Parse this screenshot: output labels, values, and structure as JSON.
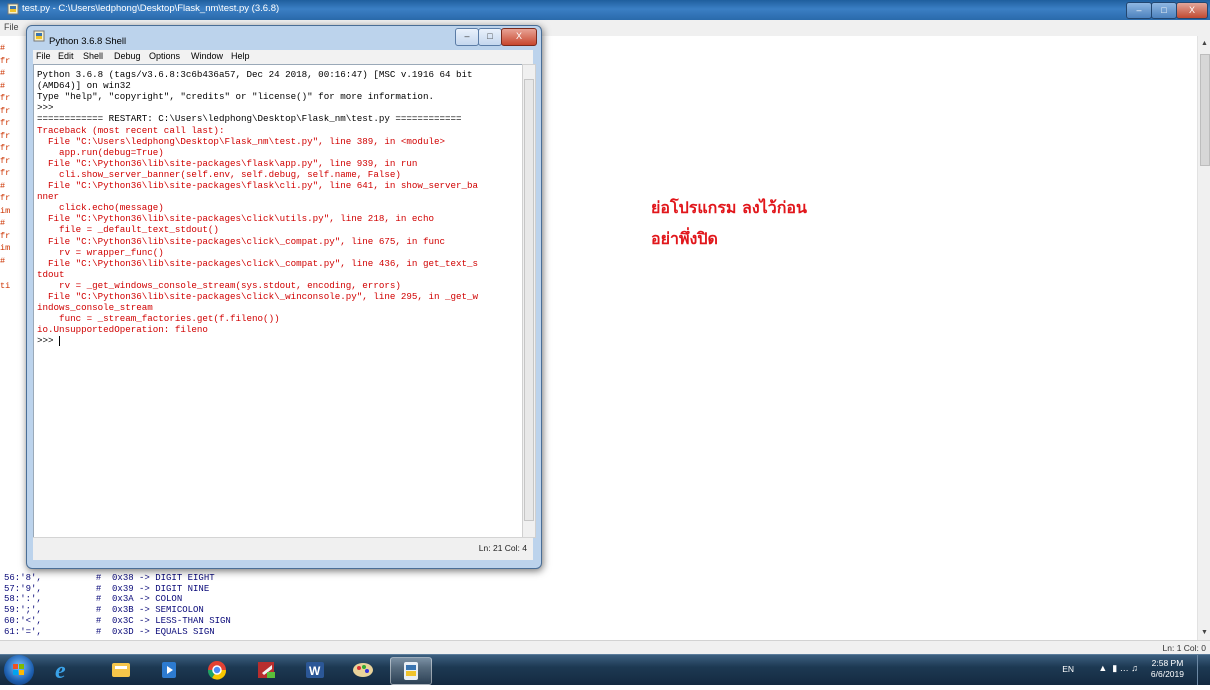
{
  "back_window": {
    "title": "test.py - C:\\Users\\ledphong\\Desktop\\Flask_nm\\test.py (3.6.8)",
    "menu": "File",
    "status": "Ln: 1  Col: 0",
    "margin_lines": [
      "#",
      "fr",
      "#",
      "#",
      "fr",
      "fr",
      "fr",
      "fr",
      "fr",
      "fr",
      "fr",
      "#",
      "fr",
      "im",
      "#",
      "fr",
      "im",
      "#",
      "",
      "ti"
    ],
    "code_lines": [
      "56:'8',          #  0x38 -> DIGIT EIGHT",
      "57:'9',          #  0x39 -> DIGIT NINE",
      "58:':',          #  0x3A -> COLON",
      "59:';',          #  0x3B -> SEMICOLON",
      "60:'<',          #  0x3C -> LESS-THAN SIGN",
      "61:'=',          #  0x3D -> EQUALS SIGN"
    ]
  },
  "shell": {
    "title": "Python 3.6.8 Shell",
    "menu": [
      "File",
      "Edit",
      "Shell",
      "Debug",
      "Options",
      "Window",
      "Help"
    ],
    "lines": [
      {
        "text": "Python 3.6.8 (tags/v3.6.8:3c6b436a57, Dec 24 2018, 00:16:47) [MSC v.1916 64 bit",
        "color": "black"
      },
      {
        "text": "(AMD64)] on win32",
        "color": "black"
      },
      {
        "text": "Type \"help\", \"copyright\", \"credits\" or \"license()\" for more information.",
        "color": "black"
      },
      {
        "text": ">>> ",
        "color": "black"
      },
      {
        "text": "============ RESTART: C:\\Users\\ledphong\\Desktop\\Flask_nm\\test.py ============",
        "color": "black"
      },
      {
        "text": "Traceback (most recent call last):",
        "color": "red"
      },
      {
        "text": "  File \"C:\\Users\\ledphong\\Desktop\\Flask_nm\\test.py\", line 389, in <module>",
        "color": "red"
      },
      {
        "text": "    app.run(debug=True)",
        "color": "red"
      },
      {
        "text": "  File \"C:\\Python36\\lib\\site-packages\\flask\\app.py\", line 939, in run",
        "color": "red"
      },
      {
        "text": "    cli.show_server_banner(self.env, self.debug, self.name, False)",
        "color": "red"
      },
      {
        "text": "  File \"C:\\Python36\\lib\\site-packages\\flask\\cli.py\", line 641, in show_server_ba",
        "color": "red"
      },
      {
        "text": "nner",
        "color": "red"
      },
      {
        "text": "    click.echo(message)",
        "color": "red"
      },
      {
        "text": "  File \"C:\\Python36\\lib\\site-packages\\click\\utils.py\", line 218, in echo",
        "color": "red"
      },
      {
        "text": "    file = _default_text_stdout()",
        "color": "red"
      },
      {
        "text": "  File \"C:\\Python36\\lib\\site-packages\\click\\_compat.py\", line 675, in func",
        "color": "red"
      },
      {
        "text": "    rv = wrapper_func()",
        "color": "red"
      },
      {
        "text": "  File \"C:\\Python36\\lib\\site-packages\\click\\_compat.py\", line 436, in get_text_s",
        "color": "red"
      },
      {
        "text": "tdout",
        "color": "red"
      },
      {
        "text": "    rv = _get_windows_console_stream(sys.stdout, encoding, errors)",
        "color": "red"
      },
      {
        "text": "  File \"C:\\Python36\\lib\\site-packages\\click\\_winconsole.py\", line 295, in _get_w",
        "color": "red"
      },
      {
        "text": "indows_console_stream",
        "color": "red"
      },
      {
        "text": "    func = _stream_factories.get(f.fileno())",
        "color": "red"
      },
      {
        "text": "io.UnsupportedOperation: fileno",
        "color": "red"
      },
      {
        "text": ">>> ",
        "color": "black"
      }
    ],
    "status": "Ln: 21  Col: 4"
  },
  "annotation": {
    "line1": "ย่อโปรแกรม ลงไว้ก่อน",
    "line2": "อย่าพึ่งปิด"
  },
  "taskbar": {
    "apps": [
      "start-orb",
      "ie-icon",
      "explorer-icon",
      "media-icon",
      "chrome-icon",
      "sublime-icon",
      "word-icon",
      "paint-icon",
      "python-icon"
    ],
    "lang": "EN",
    "time": "2:58 PM",
    "date": "6/6/2019"
  },
  "colors": {
    "traceback": "#d00000",
    "annotation": "#e1161b",
    "taskbar": "#1d3953"
  }
}
